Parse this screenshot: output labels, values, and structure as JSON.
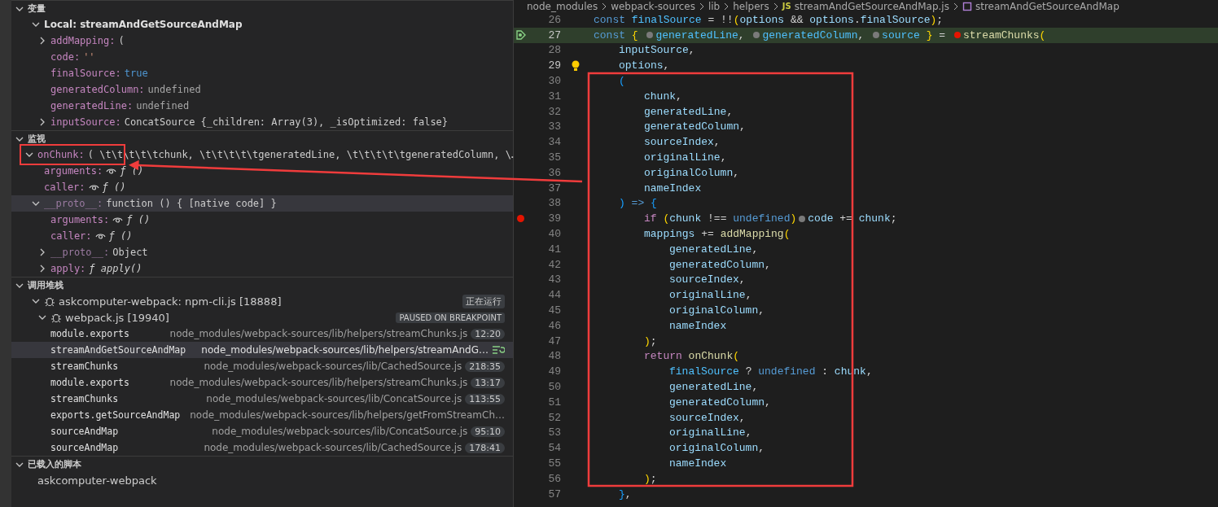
{
  "sidebar": {
    "sections": [
      {
        "kind": "variables",
        "title": "变量",
        "expanded": true,
        "scopes": [
          {
            "title": "Local: streamAndGetSourceAndMap",
            "expanded": true,
            "items": [
              {
                "name": "addMapping:",
                "value": "(",
                "kind": "object",
                "expanded": false,
                "selected": false
              },
              {
                "name": "code:",
                "value": "''",
                "kind": "string",
                "selected": false
              },
              {
                "name": "finalSource:",
                "value": "true",
                "kind": "boolean",
                "selected": false
              },
              {
                "name": "generatedColumn:",
                "value": "undefined",
                "kind": "undefined",
                "selected": false
              },
              {
                "name": "generatedLine:",
                "value": "undefined",
                "kind": "undefined",
                "selected": false
              },
              {
                "name": "inputSource:",
                "value": "ConcatSource {_children: Array(3), _isOptimized: false}",
                "kind": "object",
                "expanded": false,
                "selected": false
              }
            ]
          }
        ]
      },
      {
        "kind": "watch",
        "title": "监视",
        "expanded": true,
        "items": [
          {
            "name": "onChunk:",
            "value": "( \\t\\t\\t\\t\\tchunk, \\t\\t\\t\\t\\tgeneratedLine, \\t\\t\\t\\t\\tgeneratedColumn, \\…",
            "kind": "object",
            "expanded": true,
            "selected": false,
            "children": [
              {
                "name": "arguments:",
                "value": "ƒ ()",
                "kind": "function",
                "lazy": true,
                "selected": false
              },
              {
                "name": "caller:",
                "value": "ƒ ()",
                "kind": "function",
                "lazy": true,
                "selected": false
              },
              {
                "name": "__proto__:",
                "value": "function () { [native code] }",
                "kind": "object",
                "expanded": true,
                "dim": true,
                "selected": true,
                "children": [
                  {
                    "name": "arguments:",
                    "value": "ƒ ()",
                    "kind": "function",
                    "lazy": true,
                    "selected": false
                  },
                  {
                    "name": "caller:",
                    "value": "ƒ ()",
                    "kind": "function",
                    "lazy": true,
                    "selected": false
                  },
                  {
                    "name": "__proto__:",
                    "value": "Object",
                    "kind": "object",
                    "expanded": false,
                    "dim": true,
                    "selected": false
                  },
                  {
                    "name": "apply:",
                    "value": "ƒ apply()",
                    "kind": "function",
                    "expanded": false,
                    "selected": false
                  }
                ]
              }
            ]
          }
        ]
      },
      {
        "kind": "callstack",
        "title": "调用堆栈",
        "expanded": true,
        "sessions": [
          {
            "label": "askcomputer-webpack: npm-cli.js [18888]",
            "status": "正在运行",
            "expanded": true,
            "children": [
              {
                "label": "webpack.js [19940]",
                "status": "PAUSED ON BREAKPOINT",
                "expanded": true,
                "frames": [
                  {
                    "name": "module.exports",
                    "path": "node_modules/webpack-sources/lib/helpers/streamChunks.js",
                    "position": "12:20",
                    "selected": false
                  },
                  {
                    "name": "streamAndGetSourceAndMap",
                    "path": "node_modules/webpack-sources/lib/helpers/streamAndG…",
                    "selected": true
                  },
                  {
                    "name": "streamChunks",
                    "path": "node_modules/webpack-sources/lib/CachedSource.js",
                    "position": "218:35",
                    "selected": false
                  },
                  {
                    "name": "module.exports",
                    "path": "node_modules/webpack-sources/lib/helpers/streamChunks.js",
                    "position": "13:17",
                    "selected": false
                  },
                  {
                    "name": "streamChunks",
                    "path": "node_modules/webpack-sources/lib/ConcatSource.js",
                    "position": "113:55",
                    "selected": false
                  },
                  {
                    "name": "exports.getSourceAndMap",
                    "path": "node_modules/webpack-sources/lib/helpers/getFromStreamCh…",
                    "selected": false
                  },
                  {
                    "name": "sourceAndMap",
                    "path": "node_modules/webpack-sources/lib/ConcatSource.js",
                    "position": "95:10",
                    "selected": false
                  },
                  {
                    "name": "sourceAndMap",
                    "path": "node_modules/webpack-sources/lib/CachedSource.js",
                    "position": "178:41",
                    "selected": false
                  }
                ]
              }
            ]
          }
        ]
      },
      {
        "kind": "scripts",
        "title": "已载入的脚本",
        "expanded": true,
        "items": [
          {
            "name": "askcomputer-webpack"
          }
        ]
      }
    ]
  },
  "editor": {
    "breadcrumb": {
      "folders": [
        "node_modules",
        "webpack-sources",
        "lib",
        "helpers"
      ],
      "file_icon": "JS",
      "file": "streamAndGetSourceAndMap.js",
      "symbol": "streamAndGetSourceAndMap"
    },
    "lines": [
      {
        "number": "26",
        "tokens": [
          {
            "text": "const ",
            "kind": "keyword"
          },
          {
            "text": "finalSource",
            "kind": "constant"
          },
          {
            "text": " = !!",
            "kind": "text"
          },
          {
            "text": "(",
            "kind": "bracket1"
          },
          {
            "text": "options",
            "kind": "variable"
          },
          {
            "text": " && ",
            "kind": "text"
          },
          {
            "text": "options",
            "kind": "variable"
          },
          {
            "text": ".",
            "kind": "text"
          },
          {
            "text": "finalSource",
            "kind": "variable"
          },
          {
            "text": ")",
            "kind": "bracket1"
          },
          {
            "text": ";",
            "kind": "text"
          }
        ]
      },
      {
        "number": "27",
        "kind": "current",
        "tokens": [
          {
            "text": "const ",
            "kind": "keyword"
          },
          {
            "text": "{ ",
            "kind": "bracket1"
          },
          {
            "kind": "hint"
          },
          {
            "text": "generatedLine",
            "kind": "constant"
          },
          {
            "text": ", ",
            "kind": "text"
          },
          {
            "kind": "hint"
          },
          {
            "text": "generatedColumn",
            "kind": "constant"
          },
          {
            "text": ", ",
            "kind": "text"
          },
          {
            "kind": "hint"
          },
          {
            "text": "source ",
            "kind": "constant"
          },
          {
            "text": "}",
            "kind": "bracket1"
          },
          {
            "text": " = ",
            "kind": "text"
          },
          {
            "kind": "breakpoint"
          },
          {
            "text": "streamChunks",
            "kind": "function"
          },
          {
            "text": "(",
            "kind": "bracket1"
          }
        ],
        "children": [
          {
            "number": "28",
            "tokens": [
              {
                "text": "inputSource",
                "kind": "variable"
              },
              {
                "text": ",",
                "kind": "text"
              }
            ]
          },
          {
            "number": "29",
            "kind": "lightbulb",
            "tokens": [
              {
                "text": "options",
                "kind": "variable"
              },
              {
                "text": ",",
                "kind": "text"
              }
            ]
          },
          {
            "number": "30",
            "tokens": [
              {
                "text": "(",
                "kind": "bracket3"
              }
            ],
            "children": [
              {
                "number": "31",
                "tokens": [
                  {
                    "text": "chunk",
                    "kind": "variable"
                  },
                  {
                    "text": ",",
                    "kind": "text"
                  }
                ]
              },
              {
                "number": "32",
                "tokens": [
                  {
                    "text": "generatedLine",
                    "kind": "variable"
                  },
                  {
                    "text": ",",
                    "kind": "text"
                  }
                ]
              },
              {
                "number": "33",
                "tokens": [
                  {
                    "text": "generatedColumn",
                    "kind": "variable"
                  },
                  {
                    "text": ",",
                    "kind": "text"
                  }
                ]
              },
              {
                "number": "34",
                "tokens": [
                  {
                    "text": "sourceIndex",
                    "kind": "variable"
                  },
                  {
                    "text": ",",
                    "kind": "text"
                  }
                ]
              },
              {
                "number": "35",
                "tokens": [
                  {
                    "text": "originalLine",
                    "kind": "variable"
                  },
                  {
                    "text": ",",
                    "kind": "text"
                  }
                ]
              },
              {
                "number": "36",
                "tokens": [
                  {
                    "text": "originalColumn",
                    "kind": "variable"
                  },
                  {
                    "text": ",",
                    "kind": "text"
                  }
                ]
              },
              {
                "number": "37",
                "tokens": [
                  {
                    "text": "nameIndex",
                    "kind": "variable"
                  }
                ]
              }
            ]
          },
          {
            "number": "38",
            "tokens": [
              {
                "text": ")",
                "kind": "bracket3"
              },
              {
                "text": " => ",
                "kind": "keyword"
              },
              {
                "text": "{",
                "kind": "bracket3"
              }
            ],
            "children": [
              {
                "number": "39",
                "kind": "breakpoint",
                "tokens": [
                  {
                    "text": "if ",
                    "kind": "control"
                  },
                  {
                    "text": "(",
                    "kind": "bracket1"
                  },
                  {
                    "text": "chunk",
                    "kind": "variable"
                  },
                  {
                    "text": " !== ",
                    "kind": "text"
                  },
                  {
                    "text": "undefined",
                    "kind": "keyword"
                  },
                  {
                    "text": ")",
                    "kind": "bracket1"
                  },
                  {
                    "kind": "hint"
                  },
                  {
                    "text": "code",
                    "kind": "variable"
                  },
                  {
                    "text": " += ",
                    "kind": "text"
                  },
                  {
                    "text": "chunk",
                    "kind": "variable"
                  },
                  {
                    "text": ";",
                    "kind": "text"
                  }
                ]
              },
              {
                "number": "40",
                "tokens": [
                  {
                    "text": "mappings",
                    "kind": "variable"
                  },
                  {
                    "text": " += ",
                    "kind": "text"
                  },
                  {
                    "text": "addMapping",
                    "kind": "function"
                  },
                  {
                    "text": "(",
                    "kind": "bracket1"
                  }
                ],
                "children": [
                  {
                    "number": "41",
                    "tokens": [
                      {
                        "text": "generatedLine",
                        "kind": "variable"
                      },
                      {
                        "text": ",",
                        "kind": "text"
                      }
                    ]
                  },
                  {
                    "number": "42",
                    "tokens": [
                      {
                        "text": "generatedColumn",
                        "kind": "variable"
                      },
                      {
                        "text": ",",
                        "kind": "text"
                      }
                    ]
                  },
                  {
                    "number": "43",
                    "tokens": [
                      {
                        "text": "sourceIndex",
                        "kind": "variable"
                      },
                      {
                        "text": ",",
                        "kind": "text"
                      }
                    ]
                  },
                  {
                    "number": "44",
                    "tokens": [
                      {
                        "text": "originalLine",
                        "kind": "variable"
                      },
                      {
                        "text": ",",
                        "kind": "text"
                      }
                    ]
                  },
                  {
                    "number": "45",
                    "tokens": [
                      {
                        "text": "originalColumn",
                        "kind": "variable"
                      },
                      {
                        "text": ",",
                        "kind": "text"
                      }
                    ]
                  },
                  {
                    "number": "46",
                    "tokens": [
                      {
                        "text": "nameIndex",
                        "kind": "variable"
                      }
                    ]
                  }
                ]
              },
              {
                "number": "47",
                "tokens": [
                  {
                    "text": ")",
                    "kind": "bracket1"
                  },
                  {
                    "text": ";",
                    "kind": "text"
                  }
                ]
              },
              {
                "number": "48",
                "tokens": [
                  {
                    "text": "return ",
                    "kind": "control"
                  },
                  {
                    "text": "onChunk",
                    "kind": "function"
                  },
                  {
                    "text": "(",
                    "kind": "bracket1"
                  }
                ],
                "children": [
                  {
                    "number": "49",
                    "tokens": [
                      {
                        "text": "finalSource",
                        "kind": "constant"
                      },
                      {
                        "text": " ? ",
                        "kind": "text"
                      },
                      {
                        "text": "undefined",
                        "kind": "keyword"
                      },
                      {
                        "text": " : ",
                        "kind": "text"
                      },
                      {
                        "text": "chunk",
                        "kind": "variable"
                      },
                      {
                        "text": ",",
                        "kind": "text"
                      }
                    ]
                  },
                  {
                    "number": "50",
                    "tokens": [
                      {
                        "text": "generatedLine",
                        "kind": "variable"
                      },
                      {
                        "text": ",",
                        "kind": "text"
                      }
                    ]
                  },
                  {
                    "number": "51",
                    "tokens": [
                      {
                        "text": "generatedColumn",
                        "kind": "variable"
                      },
                      {
                        "text": ",",
                        "kind": "text"
                      }
                    ]
                  },
                  {
                    "number": "52",
                    "tokens": [
                      {
                        "text": "sourceIndex",
                        "kind": "variable"
                      },
                      {
                        "text": ",",
                        "kind": "text"
                      }
                    ]
                  },
                  {
                    "number": "53",
                    "tokens": [
                      {
                        "text": "originalLine",
                        "kind": "variable"
                      },
                      {
                        "text": ",",
                        "kind": "text"
                      }
                    ]
                  },
                  {
                    "number": "54",
                    "tokens": [
                      {
                        "text": "originalColumn",
                        "kind": "variable"
                      },
                      {
                        "text": ",",
                        "kind": "text"
                      }
                    ]
                  },
                  {
                    "number": "55",
                    "tokens": [
                      {
                        "text": "nameIndex",
                        "kind": "variable"
                      }
                    ]
                  }
                ]
              },
              {
                "number": "56",
                "tokens": [
                  {
                    "text": ")",
                    "kind": "bracket1"
                  },
                  {
                    "text": ";",
                    "kind": "text"
                  }
                ]
              }
            ]
          },
          {
            "number": "57",
            "tokens": [
              {
                "text": "}",
                "kind": "bracket3"
              },
              {
                "text": ",",
                "kind": "text"
              }
            ]
          }
        ]
      }
    ]
  }
}
